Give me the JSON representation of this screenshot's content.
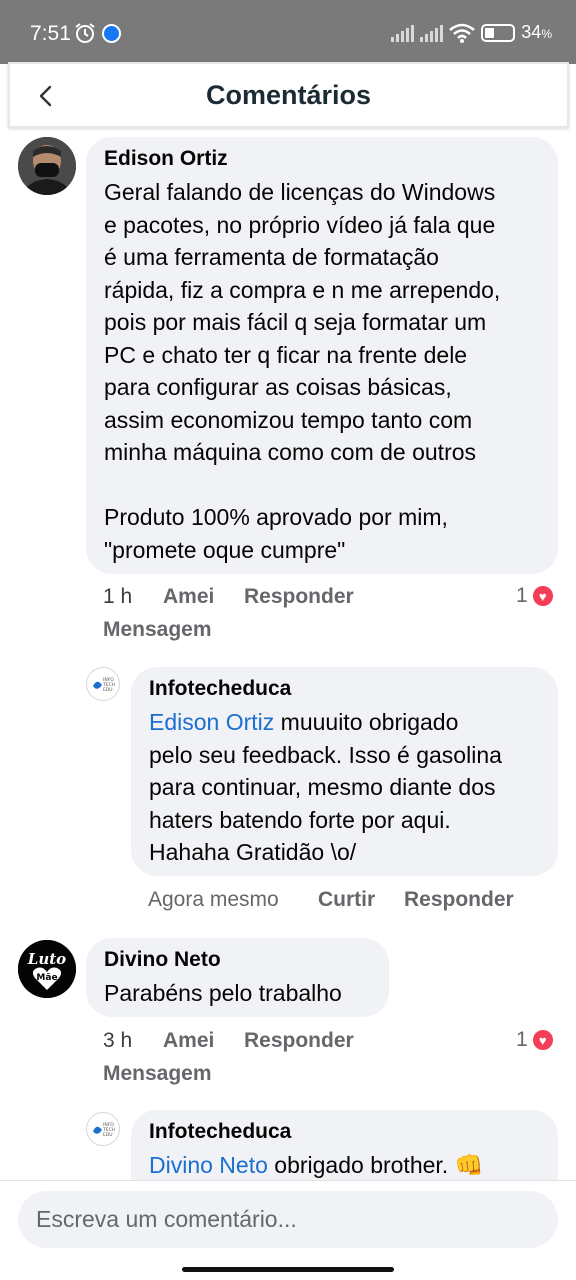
{
  "status_bar": {
    "time": "7:51",
    "battery_value": "34",
    "battery_unit": "%",
    "battery_level": 0.34
  },
  "header": {
    "title": "Comentários"
  },
  "comments": [
    {
      "author": "Edison Ortiz",
      "lines": [
        "Geral falando de licenças do Windows",
        "e pacotes, no próprio vídeo já fala que",
        "é uma ferramenta de formatação",
        "rápida, fiz a compra e n me arrependo,",
        "pois por mais fácil q seja formatar um",
        "PC e chato ter q ficar na frente dele",
        "para configurar as coisas básicas,",
        "assim economizou tempo tanto com",
        "minha máquina como com de outros",
        "",
        "Produto 100% aprovado por mim,",
        "\"promete oque cumpre\""
      ],
      "time": "1 h",
      "reaction_label": "Amei",
      "reply_label": "Responder",
      "message_label": "Mensagem",
      "reaction_count": "1"
    },
    {
      "author": "Infotecheduca",
      "mention": "Edison Ortiz",
      "lines": [
        " muuuito obrigado",
        "pelo seu feedback. Isso é gasolina",
        "para continuar, mesmo diante dos",
        "haters batendo forte por aqui.",
        "Hahaha Gratidão \\o/"
      ],
      "time": "Agora mesmo",
      "like_label": "Curtir",
      "reply_label": "Responder",
      "avatar_text": [
        "INFO",
        "TECH",
        "EDU"
      ]
    },
    {
      "author": "Divino Neto",
      "lines": [
        "Parabéns pelo trabalho"
      ],
      "time": "3 h",
      "reaction_label": "Amei",
      "reply_label": "Responder",
      "message_label": "Mensagem",
      "reaction_count": "1",
      "avatar_text": [
        "Luto",
        "Mãe"
      ]
    },
    {
      "author": "Infotecheduca",
      "mention": "Divino Neto",
      "lines": [
        " obrigado brother. 👊"
      ],
      "avatar_text": [
        "INFO",
        "TECH",
        "EDU"
      ]
    }
  ],
  "composer": {
    "placeholder": "Escreva um comentário..."
  }
}
